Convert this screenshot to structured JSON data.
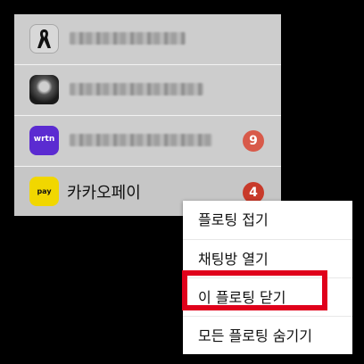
{
  "chat_list": {
    "items": [
      {
        "avatar_icon": "black-ribbon-icon",
        "name_blurred": true,
        "badge": ""
      },
      {
        "avatar_icon": "profile-photo",
        "name_blurred": true,
        "badge": ""
      },
      {
        "avatar_text": "wrtn",
        "name_blurred": true,
        "badge": "9"
      },
      {
        "avatar_text": "pay",
        "name": "카카오페이",
        "badge": "4"
      }
    ]
  },
  "context_menu": {
    "items": [
      {
        "label": "플로팅 접기"
      },
      {
        "label": "채팅방 열기"
      },
      {
        "label": "이 플로팅 닫기"
      },
      {
        "label": "모든 플로팅 숨기기"
      }
    ],
    "highlight_color": "#e0001b"
  }
}
